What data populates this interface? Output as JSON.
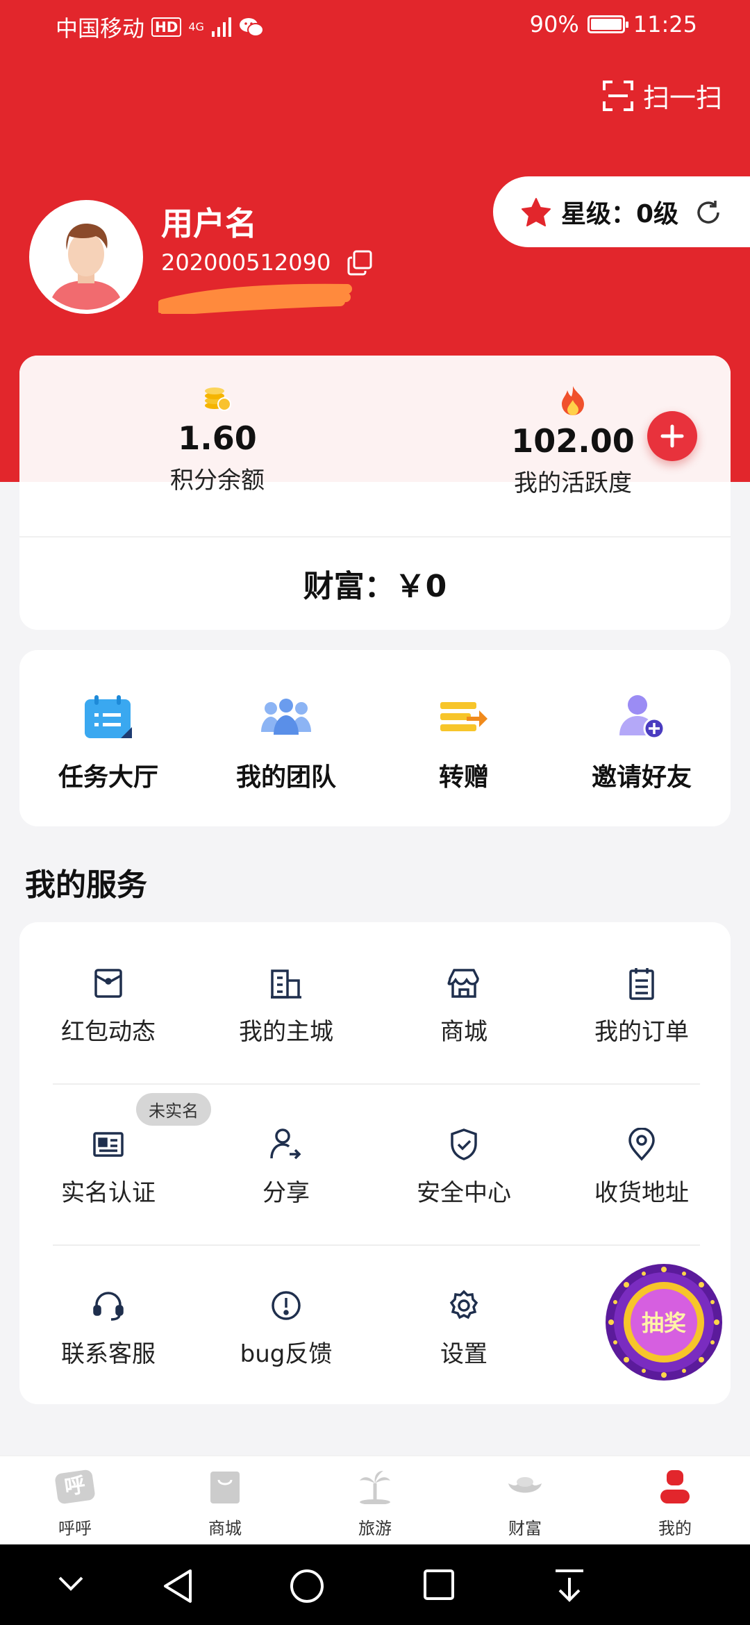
{
  "status_bar": {
    "carrier": "中国移动",
    "hd": "HD",
    "network": "4G",
    "battery": "90%",
    "battery_level": 0.9,
    "time": "11:25"
  },
  "header": {
    "scan_label": "扫一扫"
  },
  "profile": {
    "username": "用户名",
    "user_id": "202000512090",
    "star_level": "星级：0级"
  },
  "stats": {
    "points_value": "1.60",
    "points_label": "积分余额",
    "activity_value": "102.00",
    "activity_label": "我的活跃度",
    "wealth": "财富：￥0"
  },
  "quick_actions": [
    {
      "label": "任务大厅",
      "icon": "calendar-icon"
    },
    {
      "label": "我的团队",
      "icon": "team-icon"
    },
    {
      "label": "转赠",
      "icon": "transfer-icon"
    },
    {
      "label": "邀请好友",
      "icon": "invite-user-icon"
    }
  ],
  "services": {
    "title": "我的服务",
    "items": [
      {
        "label": "红包动态",
        "icon": "red-envelope-icon"
      },
      {
        "label": "我的主城",
        "icon": "building-icon"
      },
      {
        "label": "商城",
        "icon": "store-icon"
      },
      {
        "label": "我的订单",
        "icon": "order-list-icon"
      },
      {
        "label": "实名认证",
        "icon": "id-card-icon"
      },
      {
        "label": "分享",
        "icon": "share-user-icon"
      },
      {
        "label": "安全中心",
        "icon": "shield-check-icon"
      },
      {
        "label": "收货地址",
        "icon": "location-pin-icon"
      },
      {
        "label": "联系客服",
        "icon": "headset-icon"
      },
      {
        "label": "bug反馈",
        "icon": "alert-circle-icon"
      },
      {
        "label": "设置",
        "icon": "gear-icon"
      }
    ],
    "verify_badge": "未实名",
    "lottery_label": "抽奖"
  },
  "bottom_nav": [
    {
      "label": "呼呼",
      "icon_text": "呼",
      "active": false
    },
    {
      "label": "商城",
      "active": false
    },
    {
      "label": "旅游",
      "active": false
    },
    {
      "label": "财富",
      "active": false
    },
    {
      "label": "我的",
      "active": true
    }
  ],
  "colors": {
    "brand_red": "#e2262c",
    "icon_navy": "#1f2f4d",
    "inactive": "#cccccc"
  }
}
